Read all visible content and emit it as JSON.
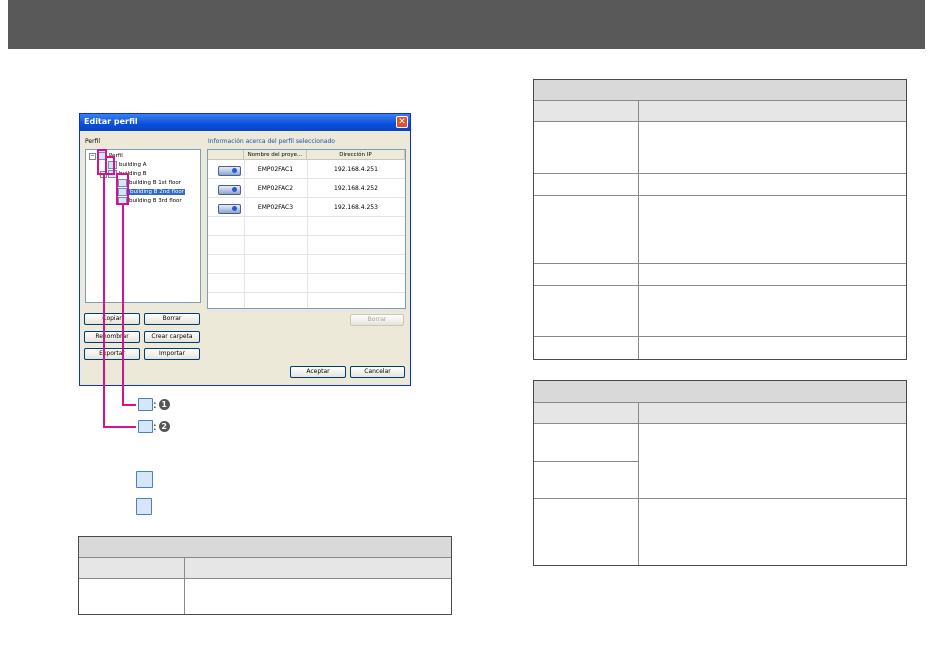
{
  "dialog": {
    "title": "Editar perfil",
    "close_glyph": "✕",
    "perfil_label": "Perfil",
    "info_label": "Información acerca del perfil seleccionado",
    "tree": [
      {
        "label": "Perfil",
        "level": 0
      },
      {
        "label": "building A",
        "level": 1
      },
      {
        "label": "building B",
        "level": 1
      },
      {
        "label": "building B 1st floor",
        "level": 2
      },
      {
        "label": "building B 2nd floor",
        "level": 2,
        "selected": true
      },
      {
        "label": "building B 3rd floor",
        "level": 2
      }
    ],
    "columns": [
      "Nombre del proye...",
      "Dirección IP"
    ],
    "rows": [
      {
        "name": "EMP02FAC1",
        "ip": "192.168.4.251"
      },
      {
        "name": "EMP02FAC2",
        "ip": "192.168.4.252"
      },
      {
        "name": "EMP02FAC3",
        "ip": "192.168.4.253"
      }
    ],
    "buttons": {
      "copiar": "Copiar",
      "borrar_left": "Borrar",
      "renombrar": "Renombrar",
      "crear_carpeta": "Crear carpeta",
      "exportar": "Exportar",
      "importar": "Importar",
      "borrar_right": "Borrar",
      "aceptar": "Aceptar",
      "cancelar": "Cancelar"
    }
  },
  "callouts": [
    {
      "label": ":",
      "number": "1"
    },
    {
      "label": ":",
      "number": "2"
    }
  ],
  "colors": {
    "header_bar": "#595959",
    "callout": "#d4148c",
    "xp_blue": "#0a4fd8"
  },
  "icons": [
    "folder-icon",
    "stacked-folder-icon",
    "projector-icon",
    "close-icon"
  ]
}
